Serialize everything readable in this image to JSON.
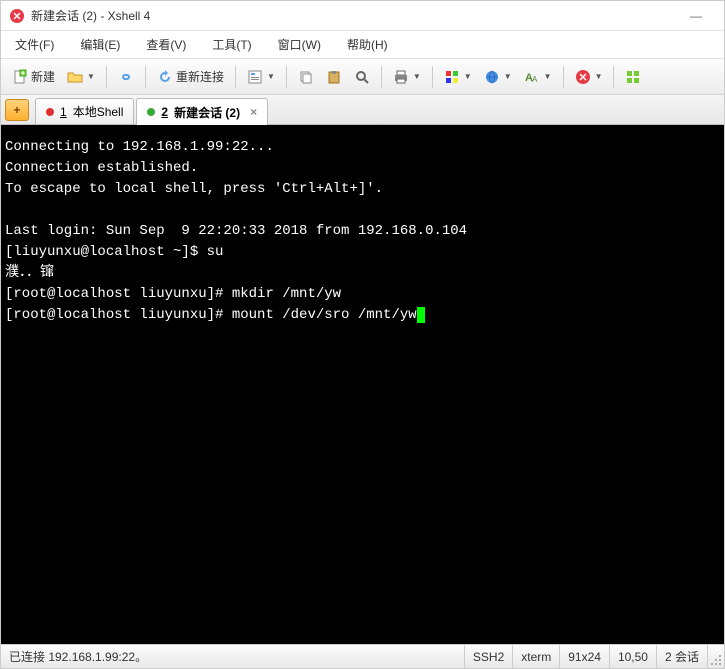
{
  "window": {
    "title": "新建会话 (2) - Xshell 4",
    "minimize": "—"
  },
  "menu": {
    "file": "文件(F)",
    "edit": "编辑(E)",
    "view": "查看(V)",
    "tools": "工具(T)",
    "window": "窗口(W)",
    "help": "帮助(H)"
  },
  "toolbar": {
    "new_label": "新建",
    "reconnect_label": "重新连接"
  },
  "tabs": {
    "add": "+",
    "local_num": "1",
    "local_label": "本地Shell",
    "session_num": "2",
    "session_label": "新建会话 (2)",
    "close": "×"
  },
  "terminal": {
    "line1": "Connecting to 192.168.1.99:22...",
    "line2": "Connection established.",
    "line3": "To escape to local shell, press 'Ctrl+Alt+]'.",
    "line4": "",
    "line5": "Last login: Sun Sep  9 22:20:33 2018 from 192.168.0.104",
    "line6": "[liuyunxu@localhost ~]$ su",
    "line7": "濮．．镩",
    "line8": "[root@localhost liuyunxu]# mkdir /mnt/yw",
    "line9": "[root@localhost liuyunxu]# mount /dev/sro /mnt/yw"
  },
  "status": {
    "connection": "已连接 192.168.1.99:22。",
    "protocol": "SSH2",
    "term": "xterm",
    "size": "91x24",
    "cursor_pos": "10,50",
    "sessions": "2 会话"
  }
}
